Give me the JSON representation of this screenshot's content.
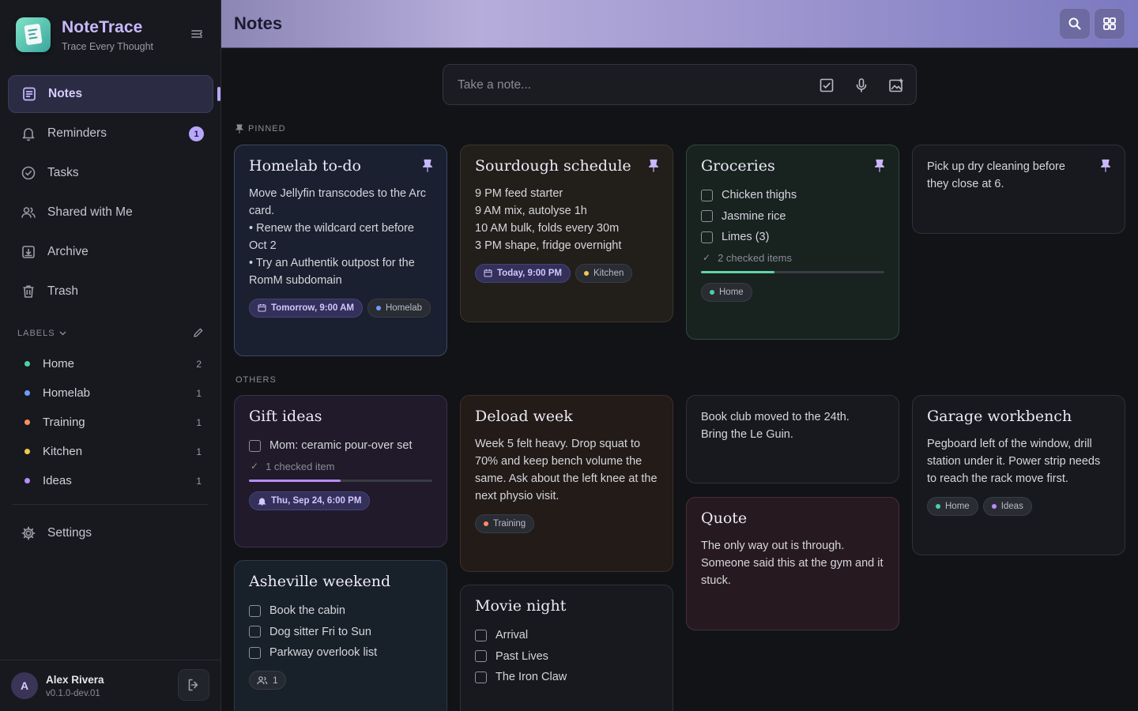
{
  "app": {
    "name": "NoteTrace",
    "tagline": "Trace Every Thought"
  },
  "nav": [
    {
      "label": "Notes",
      "icon": "notes-icon",
      "active": true
    },
    {
      "label": "Reminders",
      "icon": "bell-icon",
      "badge": "1"
    },
    {
      "label": "Tasks",
      "icon": "check-circle-icon"
    },
    {
      "label": "Shared with Me",
      "icon": "users-icon"
    },
    {
      "label": "Archive",
      "icon": "archive-icon"
    },
    {
      "label": "Trash",
      "icon": "trash-icon"
    }
  ],
  "labels_header": "LABELS",
  "labels": [
    {
      "name": "Home",
      "count": "2",
      "color": "#4fd1a1"
    },
    {
      "name": "Homelab",
      "count": "1",
      "color": "#6e9bff"
    },
    {
      "name": "Training",
      "count": "1",
      "color": "#ff8e5e"
    },
    {
      "name": "Kitchen",
      "count": "1",
      "color": "#f2c94c"
    },
    {
      "name": "Ideas",
      "count": "1",
      "color": "#b98cff"
    }
  ],
  "settings_label": "Settings",
  "user": {
    "initial": "A",
    "name": "Alex Rivera",
    "version": "v0.1.0-dev.01"
  },
  "header": {
    "title": "Notes"
  },
  "composer": {
    "placeholder": "Take a note..."
  },
  "sections": {
    "pinned": "PINNED",
    "others": "OTHERS"
  },
  "cards": {
    "homelab": {
      "title": "Homelab to-do",
      "lines": [
        "Move Jellyfin transcodes to the Arc card.",
        "• Renew the wildcard cert before Oct 2",
        "• Try an Authentik outpost for the RomM subdomain"
      ],
      "date_chip": "Tomorrow, 9:00 AM",
      "label_chip": "Homelab"
    },
    "sourdough": {
      "title": "Sourdough schedule",
      "lines": [
        "9 PM feed starter",
        "9 AM mix, autolyse 1h",
        "10 AM bulk, folds every 30m",
        "3 PM shape, fridge overnight"
      ],
      "date_chip": "Today, 9:00 PM",
      "label_chip": "Kitchen"
    },
    "groceries": {
      "title": "Groceries",
      "items": [
        "Chicken thighs",
        "Jasmine rice",
        "Limes (3)"
      ],
      "checked": "2 checked items",
      "progress": 0.4,
      "label_chip": "Home"
    },
    "drycleaning": {
      "text": "Pick up dry cleaning before they close at 6."
    },
    "gift": {
      "title": "Gift ideas",
      "items": [
        "Mom: ceramic pour-over set"
      ],
      "checked": "1 checked item",
      "progress": 0.5,
      "date_chip": "Thu, Sep 24, 6:00 PM"
    },
    "deload": {
      "title": "Deload week",
      "text": "Week 5 felt heavy. Drop squat to 70% and keep bench volume the same. Ask about the left knee at the next physio visit.",
      "label_chip": "Training"
    },
    "bookclub": {
      "text": "Book club moved to the 24th. Bring the Le Guin."
    },
    "garage": {
      "title": "Garage workbench",
      "text": "Pegboard left of the window, drill station under it. Power strip needs to reach the rack move first.",
      "chips": [
        "Home",
        "Ideas"
      ]
    },
    "quote": {
      "title": "Quote",
      "text": "The only way out is through. Someone said this at the gym and it stuck."
    },
    "asheville": {
      "title": "Asheville weekend",
      "items": [
        "Book the cabin",
        "Dog sitter Fri to Sun",
        "Parkway overlook list"
      ],
      "shared_count": "1"
    },
    "movie": {
      "title": "Movie night",
      "items": [
        "Arrival",
        "Past Lives",
        "The Iron Claw"
      ]
    }
  }
}
